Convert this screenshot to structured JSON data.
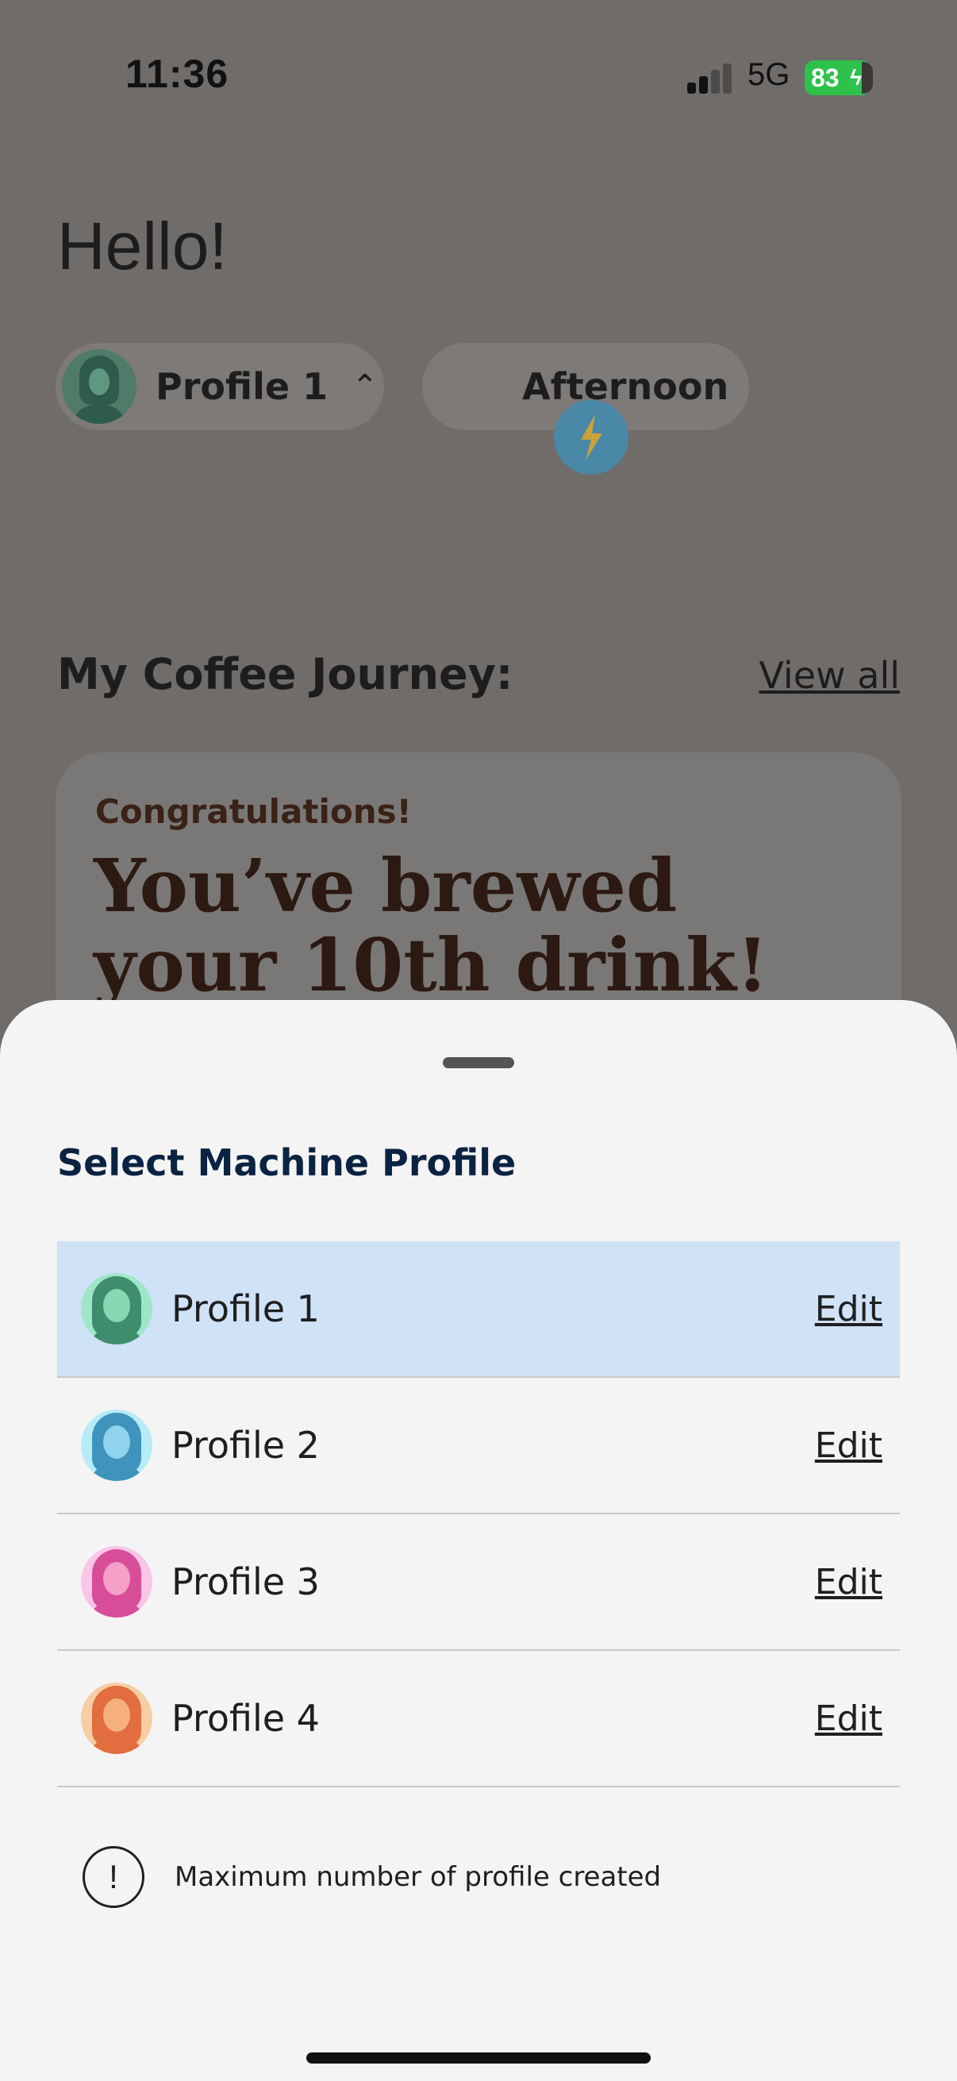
{
  "status_bar": {
    "time": "11:36",
    "network": "5G",
    "battery": "83"
  },
  "home": {
    "greeting": "Hello!",
    "profile_chip": {
      "label": "Profile 1",
      "icon": "chevron-up-icon"
    },
    "time_chip": {
      "label": "Afternoon",
      "icon": "lightning-icon"
    },
    "journey": {
      "title": "My Coffee Journey:",
      "view_all": "View all"
    },
    "card": {
      "kicker": "Congratulations!",
      "title": "You’ve brewed your 10th drink!"
    }
  },
  "sheet": {
    "title": "Select Machine Profile",
    "profiles": [
      {
        "name": "Profile 1",
        "edit": "Edit",
        "selected": true,
        "avatar_bg": "#9fe6c8",
        "hair": "#3e8d6c",
        "face": "#86d9b2",
        "body": "#3e8d6c"
      },
      {
        "name": "Profile 2",
        "edit": "Edit",
        "selected": false,
        "avatar_bg": "#b7ecf7",
        "hair": "#3f94bd",
        "face": "#8fd3ed",
        "body": "#3f94bd"
      },
      {
        "name": "Profile 3",
        "edit": "Edit",
        "selected": false,
        "avatar_bg": "#f8c6e7",
        "hair": "#d84d98",
        "face": "#f4a0c9",
        "body": "#d84d98"
      },
      {
        "name": "Profile 4",
        "edit": "Edit",
        "selected": false,
        "avatar_bg": "#f7cda5",
        "hair": "#e26d3e",
        "face": "#f5b07d",
        "body": "#e26d3e"
      }
    ],
    "notice": "Maximum number of profile created",
    "notice_icon": "alert-circle-icon"
  }
}
